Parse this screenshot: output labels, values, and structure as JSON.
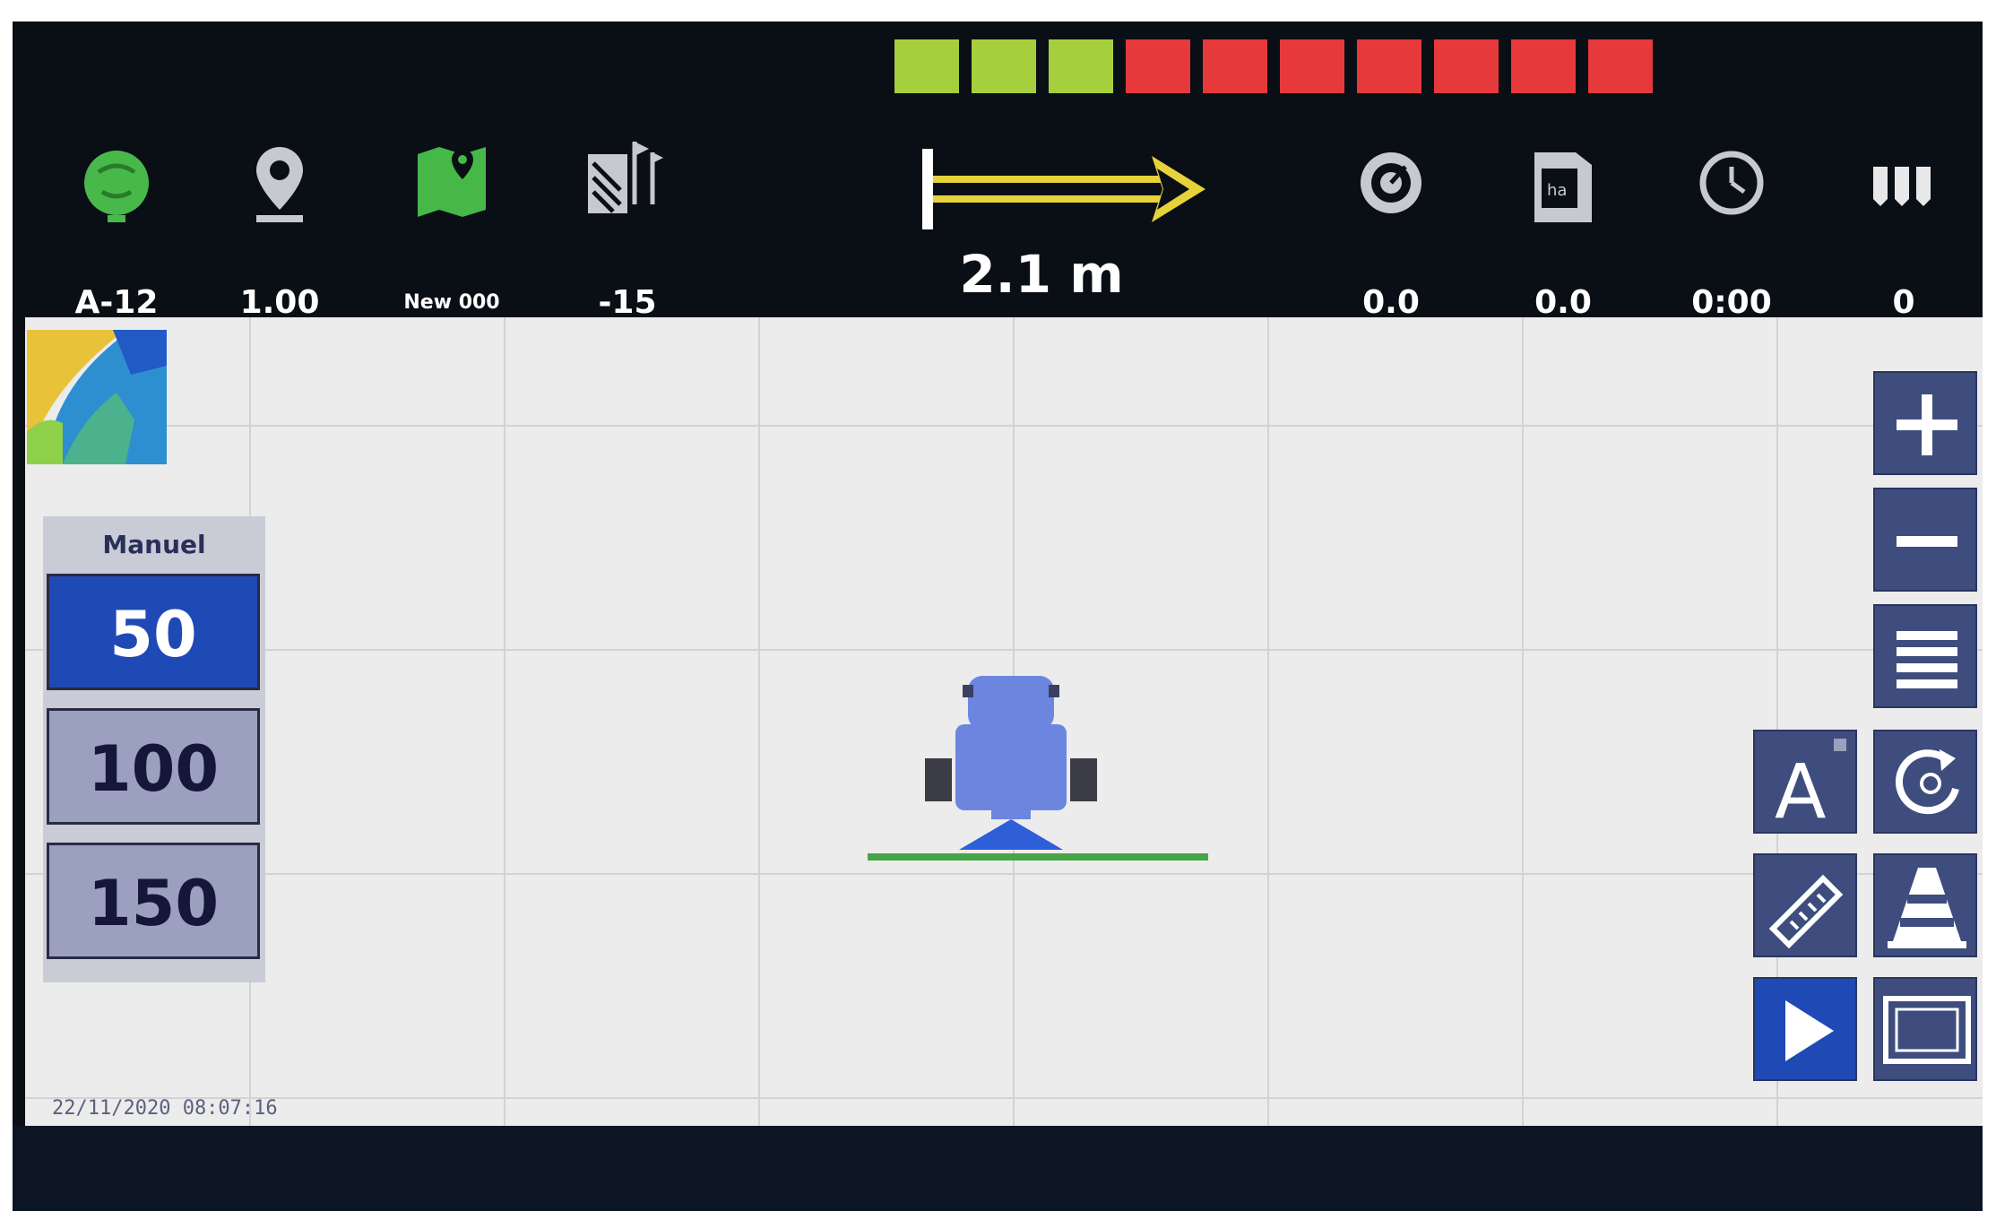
{
  "section_indicator": {
    "segments": [
      {
        "state": "on",
        "color": "#a6cf3d"
      },
      {
        "state": "on",
        "color": "#a6cf3d"
      },
      {
        "state": "on",
        "color": "#a6cf3d"
      },
      {
        "state": "off",
        "color": "#e5393b"
      },
      {
        "state": "off",
        "color": "#e5393b"
      },
      {
        "state": "off",
        "color": "#e5393b"
      },
      {
        "state": "off",
        "color": "#e5393b"
      },
      {
        "state": "off",
        "color": "#e5393b"
      },
      {
        "state": "off",
        "color": "#e5393b"
      },
      {
        "state": "off",
        "color": "#e5393b"
      }
    ]
  },
  "status_tiles": [
    {
      "icon": "satellite-icon",
      "value": "A-12"
    },
    {
      "icon": "gps-pin-icon",
      "value": "1.00"
    },
    {
      "icon": "field-map-icon",
      "value": "New 000"
    },
    {
      "icon": "headland-flags-icon",
      "value": "-15"
    },
    {
      "icon": "speed-gauge-icon",
      "value": "0.0"
    },
    {
      "icon": "area-ha-icon",
      "value": "0.0"
    },
    {
      "icon": "clock-icon",
      "value": "0:00"
    },
    {
      "icon": "section-nozzles-icon",
      "value": "0"
    }
  ],
  "lightbar": {
    "offset": "2.1 m",
    "direction": "right",
    "arrow_color": "#e6d23a"
  },
  "rate_panel": {
    "title": "Manuel",
    "options": [
      {
        "label": "50",
        "selected": true
      },
      {
        "label": "100",
        "selected": false
      },
      {
        "label": "150",
        "selected": false
      }
    ]
  },
  "map": {
    "timestamp": "22/11/2020 08:07:16",
    "boom_color": "#47a447",
    "vehicle_color": "#6c86e0"
  },
  "right_toolbar": [
    {
      "icon": "zoom-in-icon"
    },
    {
      "icon": "zoom-out-icon"
    },
    {
      "icon": "menu-icon"
    },
    {
      "icon": "auto-mode-icon",
      "label": "A"
    },
    {
      "icon": "rotate-view-icon"
    },
    {
      "icon": "ruler-icon"
    },
    {
      "icon": "cone-icon"
    },
    {
      "icon": "play-icon"
    },
    {
      "icon": "screen-layout-icon"
    }
  ]
}
